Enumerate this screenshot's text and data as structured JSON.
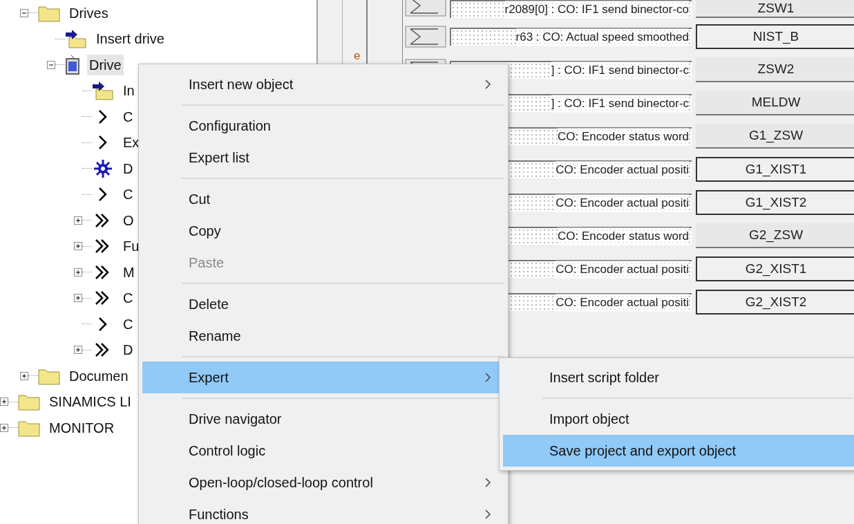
{
  "tree": {
    "project_items": [
      {
        "label": "Drives",
        "kind": "folder",
        "expanded": true,
        "children": [
          {
            "label": "Insert drive",
            "kind": "insert"
          },
          {
            "label": "Drive",
            "kind": "drive",
            "expanded": true,
            "selected": true,
            "children": [
              {
                "label": "In",
                "kind": "insert"
              },
              {
                "label": "C",
                "kind": "single"
              },
              {
                "label": "Ex",
                "kind": "single"
              },
              {
                "label": "D",
                "kind": "gear"
              },
              {
                "label": "C",
                "kind": "single"
              },
              {
                "label": "O",
                "kind": "double",
                "expanded": false
              },
              {
                "label": "Fu",
                "kind": "double",
                "expanded": false
              },
              {
                "label": "M",
                "kind": "double",
                "expanded": false
              },
              {
                "label": "C",
                "kind": "double",
                "expanded": false
              },
              {
                "label": "C",
                "kind": "single"
              },
              {
                "label": "D",
                "kind": "double",
                "expanded": false
              }
            ]
          }
        ]
      },
      {
        "label": "Documen",
        "kind": "folder",
        "expanded": false
      }
    ],
    "items": [
      {
        "label": "SINAMICS LI",
        "kind": "folder",
        "expanded": false
      },
      {
        "label": "MONITOR",
        "kind": "folder",
        "expanded": false
      }
    ]
  },
  "side_label": "e",
  "signals": [
    {
      "source": "r2089[0] : CO: IF1 send binector-co",
      "target": "ZSW1",
      "kind": "raised"
    },
    {
      "source": "r63 : CO: Actual speed smoothed",
      "target": "NIST_B",
      "kind": "framed"
    },
    {
      "source": "] : CO: IF1 send binector-c",
      "target": "ZSW2",
      "kind": "raised"
    },
    {
      "source": "] : CO: IF1 send binector-c",
      "target": "MELDW",
      "kind": "raised"
    },
    {
      "source": "CO: Encoder status word",
      "target": "G1_ZSW",
      "kind": "raised"
    },
    {
      "source": "CO: Encoder actual positi",
      "target": "G1_XIST1",
      "kind": "framed"
    },
    {
      "source": "CO: Encoder actual positi",
      "target": "G1_XIST2",
      "kind": "framed"
    },
    {
      "source": "CO: Encoder status word",
      "target": "G2_ZSW",
      "kind": "raised"
    },
    {
      "source": "CO: Encoder actual positi",
      "target": "G2_XIST1",
      "kind": "framed"
    },
    {
      "source": "CO: Encoder actual positi",
      "target": "G2_XIST2",
      "kind": "framed"
    }
  ],
  "context_menu": {
    "groups": [
      [
        {
          "label": "Insert new object",
          "has_submenu": true,
          "disabled": false,
          "selected": false
        }
      ],
      [
        {
          "label": "Configuration",
          "has_submenu": false,
          "disabled": false,
          "selected": false
        },
        {
          "label": "Expert list",
          "has_submenu": false,
          "disabled": false,
          "selected": false
        }
      ],
      [
        {
          "label": "Cut",
          "has_submenu": false,
          "disabled": false,
          "selected": false
        },
        {
          "label": "Copy",
          "has_submenu": false,
          "disabled": false,
          "selected": false
        },
        {
          "label": "Paste",
          "has_submenu": false,
          "disabled": true,
          "selected": false
        }
      ],
      [
        {
          "label": "Delete",
          "has_submenu": false,
          "disabled": false,
          "selected": false
        },
        {
          "label": "Rename",
          "has_submenu": false,
          "disabled": false,
          "selected": false
        }
      ],
      [
        {
          "label": "Expert",
          "has_submenu": true,
          "disabled": false,
          "selected": true
        }
      ],
      [
        {
          "label": "Drive navigator",
          "has_submenu": false,
          "disabled": false,
          "selected": false
        },
        {
          "label": "Control logic",
          "has_submenu": false,
          "disabled": false,
          "selected": false
        },
        {
          "label": "Open-loop/closed-loop control",
          "has_submenu": true,
          "disabled": false,
          "selected": false
        },
        {
          "label": "Functions",
          "has_submenu": true,
          "disabled": false,
          "selected": false
        }
      ]
    ]
  },
  "submenu": {
    "groups": [
      [
        {
          "label": "Insert script folder",
          "selected": false
        }
      ],
      [
        {
          "label": "Import object",
          "selected": false
        },
        {
          "label": "Save project and export object",
          "selected": true
        }
      ]
    ]
  }
}
